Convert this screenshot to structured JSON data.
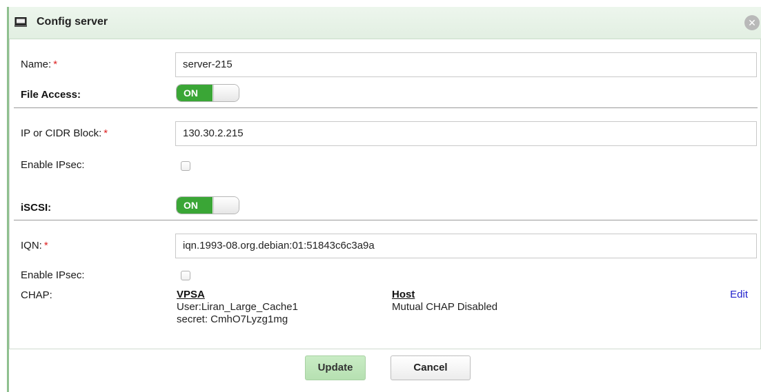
{
  "dialog": {
    "title": "Config server",
    "title_icon": "monitor-icon",
    "close_icon": "close-icon"
  },
  "form": {
    "name": {
      "label": "Name:",
      "required": "*",
      "value": "server-215"
    },
    "file_access": {
      "label": "File Access:",
      "toggle_state": "ON"
    },
    "ip": {
      "label": "IP or CIDR Block:",
      "required": "*",
      "value": "130.30.2.215"
    },
    "ip_ipsec": {
      "label": "Enable IPsec:",
      "checked": false
    },
    "iscsi": {
      "label": "iSCSI:",
      "toggle_state": "ON"
    },
    "iqn": {
      "label": "IQN:",
      "required": "*",
      "value": "iqn.1993-08.org.debian:01:51843c6c3a9a"
    },
    "iqn_ipsec": {
      "label": "Enable IPsec:",
      "checked": false
    },
    "chap": {
      "label": "CHAP:",
      "vpsa": {
        "heading": "VPSA",
        "user": "User:Liran_Large_Cache1",
        "secret": "secret: CmhO7Lyzg1mg"
      },
      "host": {
        "heading": "Host",
        "status": "Mutual CHAP Disabled"
      },
      "edit_label": "Edit"
    }
  },
  "footer": {
    "update_label": "Update",
    "cancel_label": "Cancel"
  },
  "colors": {
    "toggle_on": "#3aa636",
    "required_star": "#dd2222",
    "link": "#2222cc",
    "titlebar": "#e6f2e6"
  }
}
